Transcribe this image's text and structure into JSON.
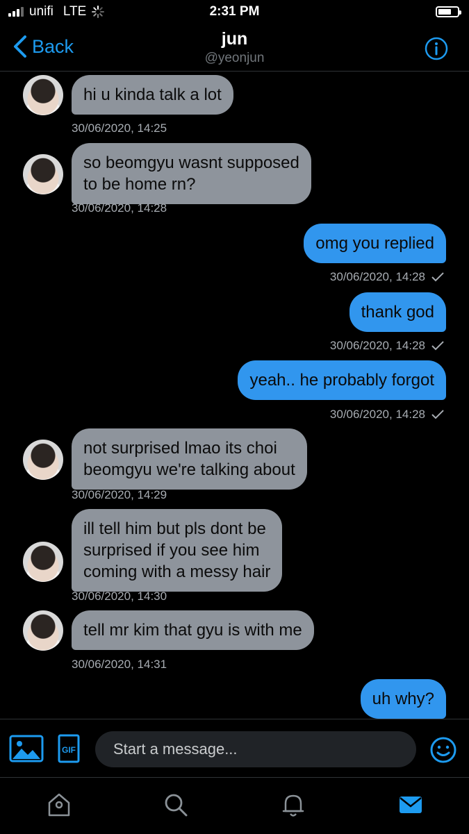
{
  "status": {
    "carrier": "unifi",
    "network": "LTE",
    "time": "2:31 PM"
  },
  "header": {
    "back_label": "Back",
    "title": "jun",
    "handle": "@yeonjun"
  },
  "messages": [
    {
      "side": "in",
      "lines": [
        "hi u kinda talk a lot"
      ],
      "time": "30/06/2020, 14:25"
    },
    {
      "side": "in",
      "lines": [
        "so beomgyu wasnt supposed",
        "to be home rn?"
      ],
      "time": "30/06/2020, 14:28"
    },
    {
      "side": "out",
      "lines": [
        "omg you replied"
      ],
      "time": "30/06/2020, 14:28"
    },
    {
      "side": "out",
      "lines": [
        "thank god"
      ],
      "time": "30/06/2020, 14:28"
    },
    {
      "side": "out",
      "lines": [
        "yeah.. he probably forgot"
      ],
      "time": "30/06/2020, 14:28"
    },
    {
      "side": "in",
      "lines": [
        "not surprised lmao its choi",
        "beomgyu we're talking about"
      ],
      "time": "30/06/2020, 14:29"
    },
    {
      "side": "in",
      "lines": [
        "ill tell him but pls dont be",
        "surprised if you see him",
        "coming with a messy hair"
      ],
      "time": "30/06/2020, 14:30"
    },
    {
      "side": "in",
      "lines": [
        "tell mr kim that gyu is with me"
      ],
      "time": "30/06/2020, 14:31"
    },
    {
      "side": "out",
      "lines": [
        "uh why?"
      ],
      "time": ""
    }
  ],
  "composer": {
    "placeholder": "Start a message...",
    "gif_label": "GIF"
  },
  "tabs": [
    "home-icon",
    "search-icon",
    "notifications-icon",
    "messages-icon"
  ],
  "colors": {
    "accent": "#1d9bf0",
    "outgoing_bubble": "#3196ee",
    "incoming_bubble": "#8e949c",
    "background": "#000000"
  }
}
